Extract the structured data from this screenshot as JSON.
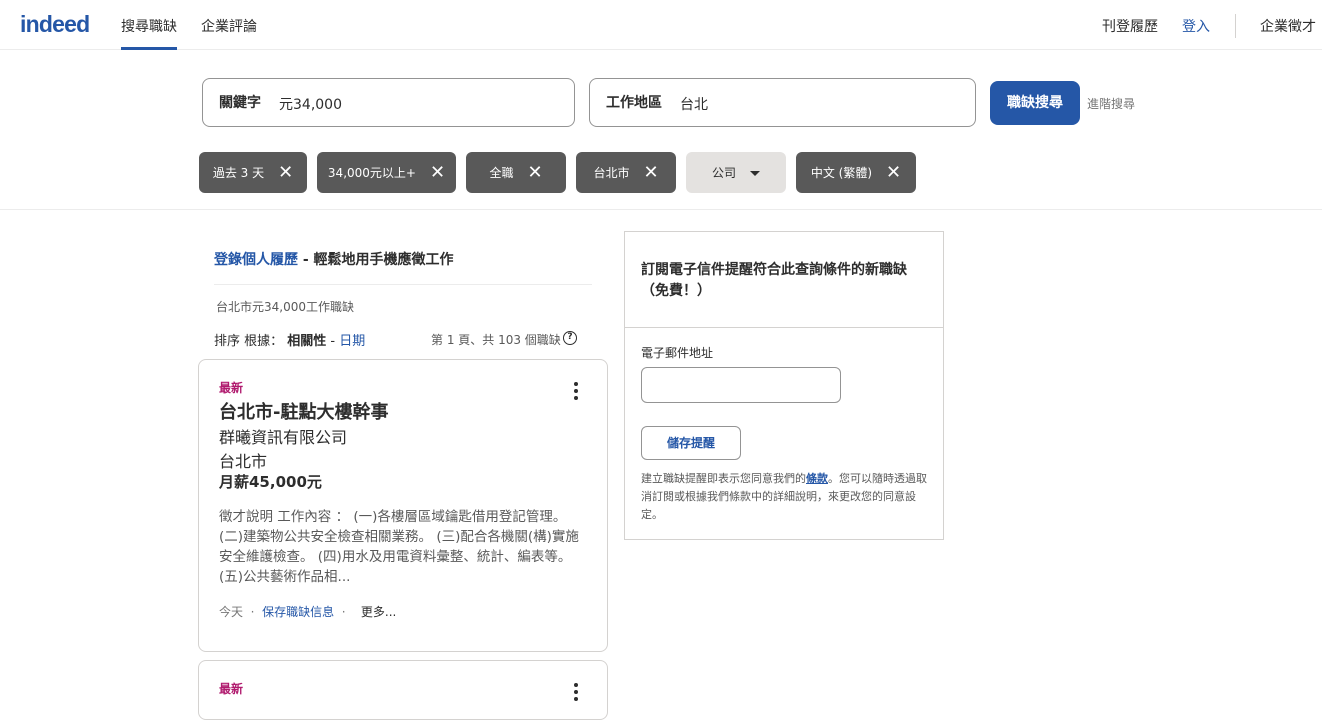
{
  "header": {
    "logo": "indeed",
    "nav": [
      {
        "label": "搜尋職缺",
        "active": true
      },
      {
        "label": "企業評論",
        "active": false
      }
    ],
    "post_resume": "刊登履歷",
    "login": "登入",
    "employers": "企業徵才"
  },
  "search": {
    "keyword_label": "關鍵字",
    "keyword_value": "元34,000",
    "location_label": "工作地區",
    "location_value": "台北",
    "button": "職缺搜尋",
    "advanced": "進階搜尋"
  },
  "filters": [
    {
      "label": "過去 3 天",
      "icon": "close-icon"
    },
    {
      "label": "34,000元以上+",
      "icon": "close-icon"
    },
    {
      "label": "全職",
      "icon": "close-icon"
    },
    {
      "label": "台北市",
      "icon": "close-icon"
    },
    {
      "label": "公司",
      "icon": "chevron-down-icon"
    },
    {
      "label": "中文 (繁體)",
      "icon": "close-icon"
    }
  ],
  "promo": {
    "link": "登錄個人履歷",
    "text": " - 輕鬆地用手機應徵工作"
  },
  "results": {
    "subtitle": "台北市元34,000工作職缺",
    "sort_prefix": "排序 根據：",
    "sort_relevance": "相關性",
    "sort_sep": " - ",
    "sort_date": "日期",
    "page_info": "第 1 頁、共 103 個職缺",
    "help": "?"
  },
  "jobs": [
    {
      "tag": "最新",
      "title": "台北市-駐點大樓幹事",
      "company": "群曦資訊有限公司",
      "location": "台北市",
      "salary": "月薪45,000元",
      "description": "徵才說明 工作內容 ： (一)各樓層區域鑰匙借用登記管理。 (二)建築物公共安全檢查相關業務。 (三)配合各機關(構)實施安全維護檢查。 (四)用水及用電資料彙整、統計、編表等。 (五)公共藝術作品相...",
      "posted": "今天",
      "save": "保存職缺信息",
      "more": "更多...",
      "dot": "·"
    },
    {
      "tag": "最新"
    }
  ],
  "alert": {
    "title": "訂閱電子信件提醒符合此查詢條件的新職缺（免費！）",
    "email_label": "電子郵件地址",
    "save_button": "儲存提醒",
    "terms_prefix": "建立職缺提醒即表示您同意我們的",
    "terms_link": "條款",
    "terms_suffix": "。您可以隨時透過取消訂閱或根據我們條款中的詳細說明，來更改您的同意設定。"
  }
}
